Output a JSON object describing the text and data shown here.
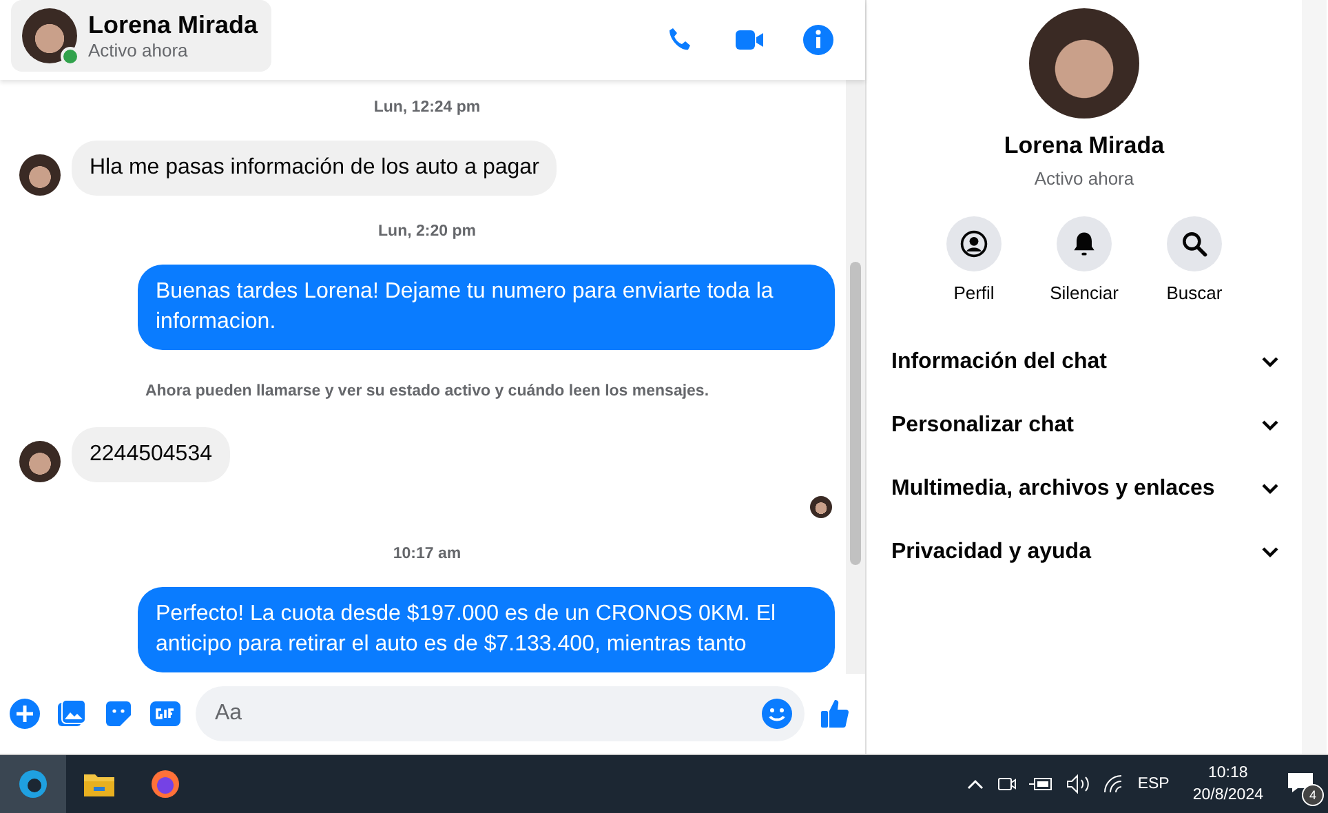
{
  "header": {
    "name": "Lorena Mirada",
    "status": "Activo ahora",
    "online": true
  },
  "messages": [
    {
      "kind": "timestamp",
      "text": "Lun, 12:24 pm"
    },
    {
      "kind": "incoming",
      "text": "Hla me pasas información de los auto a pagar"
    },
    {
      "kind": "timestamp",
      "text": "Lun, 2:20 pm"
    },
    {
      "kind": "outgoing",
      "text": "Buenas tardes Lorena! Dejame tu numero para enviarte toda la informacion."
    },
    {
      "kind": "notice",
      "text": "Ahora pueden llamarse y ver su estado activo y cuándo leen los mensajes."
    },
    {
      "kind": "incoming",
      "text": "2244504534"
    },
    {
      "kind": "seen"
    },
    {
      "kind": "timestamp",
      "text": "10:17 am"
    },
    {
      "kind": "outgoing",
      "text": "Perfecto! La cuota desde $197.000 es de un CRONOS 0KM. El anticipo para retirar el auto es de $7.133.400, mientras tanto"
    }
  ],
  "composer": {
    "placeholder": "Aa"
  },
  "profile": {
    "name": "Lorena Mirada",
    "status": "Activo ahora",
    "actions": [
      {
        "kind": "profile",
        "label": "Perfil"
      },
      {
        "kind": "mute",
        "label": "Silenciar"
      },
      {
        "kind": "search",
        "label": "Buscar"
      }
    ],
    "sections": [
      {
        "label": "Información del chat",
        "expanded": false
      },
      {
        "label": "Personalizar chat",
        "expanded": false
      },
      {
        "label": "Multimedia, archivos y enlaces",
        "expanded": false
      },
      {
        "label": "Privacidad y ayuda",
        "expanded": false
      }
    ]
  },
  "taskbar": {
    "language": "ESP",
    "time": "10:18",
    "date": "20/8/2024",
    "notifications": "4"
  }
}
